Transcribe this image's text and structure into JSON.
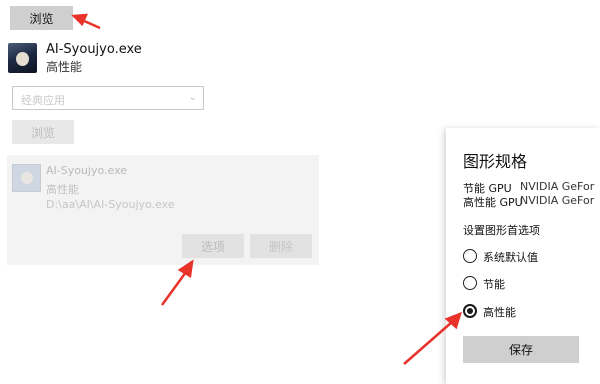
{
  "top": {
    "browse_label": "浏览"
  },
  "app1": {
    "name": "AI-Syoujyo.exe",
    "perf": "高性能"
  },
  "dropdown": {
    "value": "经典应用"
  },
  "browse2_label": "浏览",
  "app2": {
    "name": "AI-Syoujyo.exe",
    "perf": "高性能",
    "path": "D:\\aa\\AI\\AI-Syoujyo.exe",
    "options_label": "选项",
    "delete_label": "删除"
  },
  "dialog": {
    "title": "图形规格",
    "gpu_power_saving_label": "节能 GPU",
    "gpu_power_saving_value": "NVIDIA GeFor",
    "gpu_high_perf_label": "高性能 GPU",
    "gpu_high_perf_value": "NVIDIA GeFor",
    "pref_label": "设置图形首选项",
    "options": [
      {
        "label": "系统默认值",
        "checked": false
      },
      {
        "label": "节能",
        "checked": false
      },
      {
        "label": "高性能",
        "checked": true
      }
    ],
    "save_label": "保存"
  },
  "colors": {
    "annotation_arrow": "#e8322a"
  }
}
